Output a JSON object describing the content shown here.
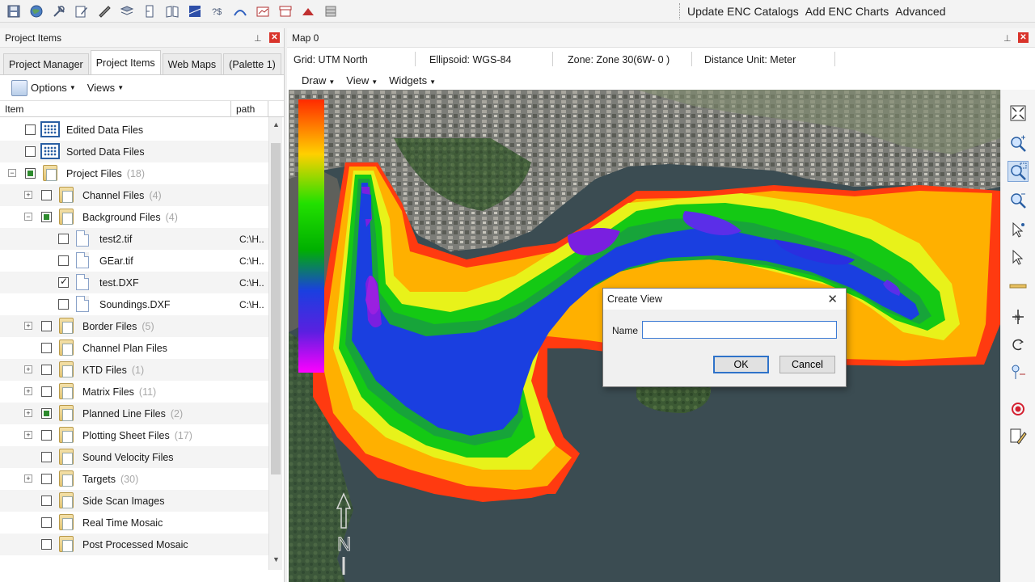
{
  "toolbar": {
    "icons": [
      "save-icon",
      "globe-icon",
      "tools-icon",
      "edit-icon",
      "ruler-icon",
      "layers-icon",
      "page-icon",
      "book-icon",
      "map-flag-icon",
      "query-icon",
      "survey-icon",
      "chart-icon",
      "archive-icon",
      "mountain-icon",
      "grid-icon"
    ],
    "links": [
      "Update ENC Catalogs",
      "Add ENC Charts",
      "Advanced"
    ]
  },
  "left_panel": {
    "title": "Project Items",
    "tabs": [
      "Project Manager",
      "Project Items",
      "Web Maps",
      "(Palette 1)"
    ],
    "options_label": "Options",
    "views_label": "Views",
    "columns": {
      "item": "Item",
      "path": "path"
    },
    "rows": [
      {
        "label": "Edited Data Files",
        "count": "",
        "path": ""
      },
      {
        "label": "Sorted Data Files",
        "count": "",
        "path": ""
      },
      {
        "label": "Project Files",
        "count": "(18)",
        "path": ""
      },
      {
        "label": "Channel Files",
        "count": "(4)",
        "path": ""
      },
      {
        "label": "Background Files",
        "count": "(4)",
        "path": ""
      },
      {
        "label": "test2.tif",
        "count": "",
        "path": "C:\\H.."
      },
      {
        "label": "GEar.tif",
        "count": "",
        "path": "C:\\H.."
      },
      {
        "label": "test.DXF",
        "count": "",
        "path": "C:\\H.."
      },
      {
        "label": "Soundings.DXF",
        "count": "",
        "path": "C:\\H.."
      },
      {
        "label": "Border Files",
        "count": "(5)",
        "path": ""
      },
      {
        "label": "Channel Plan Files",
        "count": "",
        "path": ""
      },
      {
        "label": "KTD Files",
        "count": "(1)",
        "path": ""
      },
      {
        "label": "Matrix Files",
        "count": "(11)",
        "path": ""
      },
      {
        "label": "Planned Line Files",
        "count": "(2)",
        "path": ""
      },
      {
        "label": "Plotting Sheet Files",
        "count": "(17)",
        "path": ""
      },
      {
        "label": "Sound Velocity Files",
        "count": "",
        "path": ""
      },
      {
        "label": "Targets",
        "count": "(30)",
        "path": ""
      },
      {
        "label": "Side Scan Images",
        "count": "",
        "path": ""
      },
      {
        "label": "Real Time Mosaic",
        "count": "",
        "path": ""
      },
      {
        "label": "Post Processed Mosaic",
        "count": "",
        "path": ""
      }
    ]
  },
  "map_panel": {
    "title": "Map 0",
    "status": {
      "grid": "Grid: UTM North",
      "ellipsoid": "Ellipsoid: WGS-84",
      "zone": "Zone: Zone 30(6W- 0 )",
      "distance_unit": "Distance Unit: Meter"
    },
    "menu": [
      "Draw",
      "View",
      "Widgets"
    ],
    "north_label": "N",
    "right_tools": [
      "fit-extent-icon",
      "zoom-in-icon",
      "zoom-window-icon",
      "zoom-out-icon",
      "select-point-icon",
      "select-arrow-icon",
      "ruler-line-icon",
      "north-arrow-icon",
      "rotate-icon",
      "measure-pin-icon",
      "target-icon",
      "edit-pencil-icon"
    ],
    "colors": {
      "deep": "#7a1fe0",
      "blue": "#1a3fe0",
      "green": "#14c914",
      "yellow": "#e8f21a",
      "orange": "#ffb000",
      "red": "#ff3a10"
    }
  },
  "dialog": {
    "title": "Create View",
    "name_label": "Name",
    "name_value": "",
    "ok_label": "OK",
    "cancel_label": "Cancel"
  }
}
